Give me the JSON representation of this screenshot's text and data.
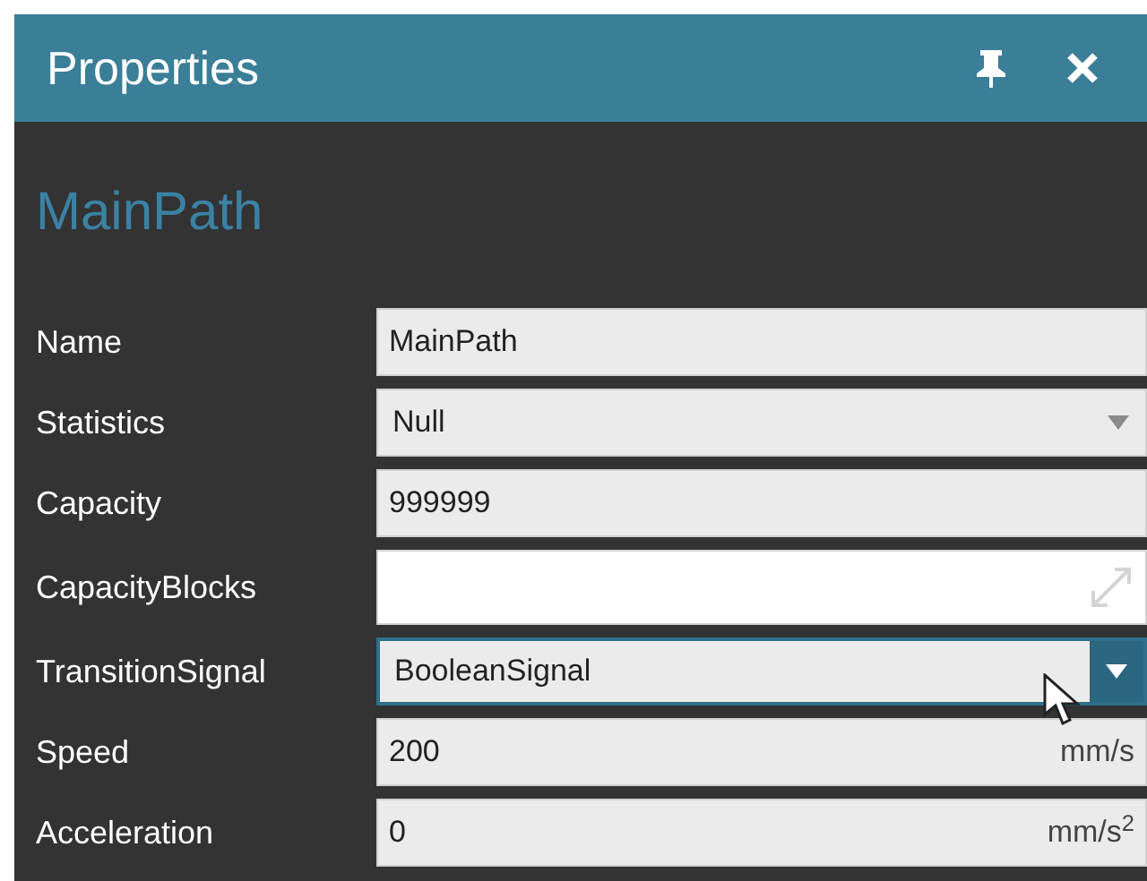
{
  "window": {
    "title": "Properties"
  },
  "object_name": "MainPath",
  "properties": [
    {
      "label": "Name",
      "kind": "text",
      "value": "MainPath",
      "focused": false
    },
    {
      "label": "Statistics",
      "kind": "combo",
      "value": "Null",
      "focused": false
    },
    {
      "label": "Capacity",
      "kind": "text",
      "value": "999999",
      "focused": false
    },
    {
      "label": "CapacityBlocks",
      "kind": "editor",
      "focused": false
    },
    {
      "label": "TransitionSignal",
      "kind": "combo",
      "value": "BooleanSignal",
      "focused": true
    },
    {
      "label": "Speed",
      "kind": "unit",
      "value": "200",
      "unit": "mm/s",
      "focused": false
    },
    {
      "label": "Acceleration",
      "kind": "unit",
      "value": "0",
      "unit": "mm/s$^{2}$",
      "focused": false
    }
  ]
}
